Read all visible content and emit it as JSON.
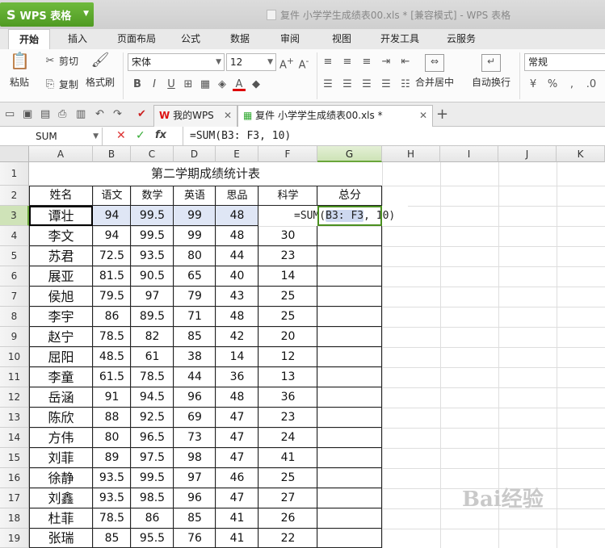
{
  "app": {
    "name": "WPS 表格",
    "logo": "S"
  },
  "window_title": "复件 小学学生成绩表00.xls * [兼容模式] - WPS 表格",
  "ribbon_tabs": [
    "开始",
    "插入",
    "页面布局",
    "公式",
    "数据",
    "审阅",
    "视图",
    "开发工具",
    "云服务"
  ],
  "ribbon": {
    "paste": "粘贴",
    "cut": "剪切",
    "copy": "复制",
    "format_painter": "格式刷",
    "font_name": "宋体",
    "font_size": "12",
    "merge_center": "合并居中",
    "wrap_text": "自动换行",
    "number_format": "常规"
  },
  "doc_tabs": [
    {
      "label": "我的WPS"
    },
    {
      "label": "复件 小学学生成绩表00.xls *"
    }
  ],
  "formula_bar": {
    "name_box": "SUM",
    "formula": "=SUM(B3: F3, 10)"
  },
  "columns": [
    "A",
    "B",
    "C",
    "D",
    "E",
    "F",
    "G",
    "H",
    "I",
    "J",
    "K"
  ],
  "row_numbers": [
    "1",
    "2",
    "3",
    "4",
    "5",
    "6",
    "7",
    "8",
    "9",
    "10",
    "11",
    "12",
    "13",
    "14",
    "15",
    "16",
    "17",
    "18",
    "19"
  ],
  "sheet": {
    "title": "第二学期成绩统计表",
    "headers": [
      "姓名",
      "语文",
      "数学",
      "英语",
      "思品",
      "科学",
      "总分"
    ],
    "rows": [
      [
        "谭壮",
        "94",
        "99.5",
        "99",
        "48",
        ""
      ],
      [
        "李文",
        "94",
        "99.5",
        "99",
        "48",
        "30"
      ],
      [
        "苏君",
        "72.5",
        "93.5",
        "80",
        "44",
        "23"
      ],
      [
        "展亚",
        "81.5",
        "90.5",
        "65",
        "40",
        "14"
      ],
      [
        "侯旭",
        "79.5",
        "97",
        "79",
        "43",
        "25"
      ],
      [
        "李宇",
        "86",
        "89.5",
        "71",
        "48",
        "25"
      ],
      [
        "赵宁",
        "78.5",
        "82",
        "85",
        "42",
        "20"
      ],
      [
        "屈阳",
        "48.5",
        "61",
        "38",
        "14",
        "12"
      ],
      [
        "李童",
        "61.5",
        "78.5",
        "44",
        "36",
        "13"
      ],
      [
        "岳涵",
        "91",
        "94.5",
        "96",
        "48",
        "36"
      ],
      [
        "陈欣",
        "88",
        "92.5",
        "69",
        "47",
        "23"
      ],
      [
        "方伟",
        "80",
        "96.5",
        "73",
        "47",
        "24"
      ],
      [
        "刘菲",
        "89",
        "97.5",
        "98",
        "47",
        "41"
      ],
      [
        "徐静",
        "93.5",
        "99.5",
        "97",
        "46",
        "25"
      ],
      [
        "刘鑫",
        "93.5",
        "98.5",
        "96",
        "47",
        "27"
      ],
      [
        "杜菲",
        "78.5",
        "86",
        "85",
        "41",
        "26"
      ],
      [
        "张瑞",
        "85",
        "95.5",
        "76",
        "41",
        "22"
      ]
    ],
    "editing_formula": {
      "prefix": "=SUM(",
      "ref": "B3: F3",
      "suffix": ", 10)"
    }
  },
  "watermark": "Bai经验",
  "colors": {
    "wps_green": "#5aa52a",
    "selection_blue": "#dfe6f5",
    "active_border": "#4a8f1f"
  }
}
